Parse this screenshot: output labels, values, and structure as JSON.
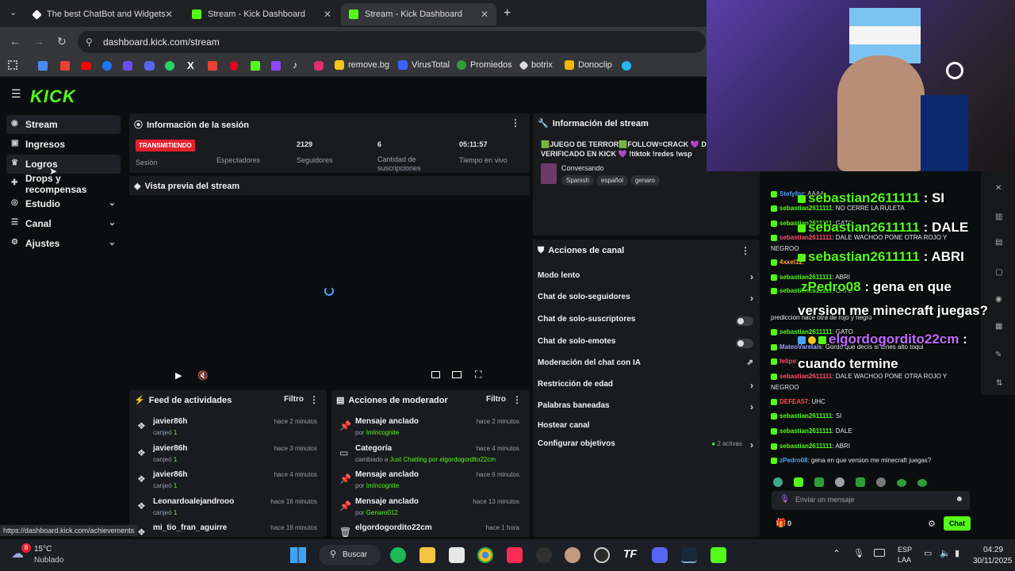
{
  "browser": {
    "tabs": [
      {
        "title": "The best ChatBot and Widgets"
      },
      {
        "title": "Stream - Kick Dashboard"
      },
      {
        "title": "Stream - Kick Dashboard"
      }
    ],
    "url": "dashboard.kick.com/stream",
    "bookmarks": [
      "remove.bg",
      "VirusTotal",
      "Promiedos",
      "botrix",
      "Donoclip"
    ],
    "status_url": "https://dashboard.kick.com/achievements"
  },
  "sidebar": {
    "items": [
      {
        "label": "Stream"
      },
      {
        "label": "Ingresos"
      },
      {
        "label": "Logros"
      },
      {
        "label": "Drops y recompensas"
      },
      {
        "label": "Estudio"
      },
      {
        "label": "Canal"
      },
      {
        "label": "Ajustes"
      }
    ]
  },
  "session": {
    "title": "Información de la sesión",
    "live_badge": "TRANSMITIENDO",
    "session_label": "Sesión",
    "viewers_label": "Espectadores",
    "followers_value": "2129",
    "followers_label": "Seguidores",
    "subs_value": "6",
    "subs_label": "Cantidad de suscripciones",
    "live_time_value": "05:11:57",
    "live_time_label": "Tiempo en vivo"
  },
  "preview": {
    "title": "Vista previa del stream"
  },
  "stream_info": {
    "title": "Información del stream",
    "stream_title": "🟩JUEGO DE TERROR🟩FOLLOW=CRACK 💜 DE ( VERIFICADO EN KICK 💜 !tiktok !redes !wsp",
    "category": "Conversando",
    "tags": [
      "Spanish",
      "español",
      "genaro"
    ]
  },
  "channel_actions": {
    "title": "Acciones de canal",
    "items": [
      {
        "label": "Modo lento",
        "kind": "arrow"
      },
      {
        "label": "Chat de solo-seguidores",
        "kind": "arrow"
      },
      {
        "label": "Chat de solo-suscriptores",
        "kind": "toggle"
      },
      {
        "label": "Chat de solo-emotes",
        "kind": "toggle"
      },
      {
        "label": "Moderación del chat con IA",
        "kind": "link"
      },
      {
        "label": "Restricción de edad",
        "kind": "arrow"
      },
      {
        "label": "Palabras baneadas",
        "kind": "arrow"
      },
      {
        "label": "Hostear canal",
        "kind": "none"
      },
      {
        "label": "Configurar objetivos",
        "kind": "arrow"
      }
    ],
    "goals_status": "2 activas"
  },
  "activity_feed": {
    "title": "Feed de actividades",
    "filter": "Filtro",
    "items": [
      {
        "user": "javier86h",
        "detail_prefix": "canjeó",
        "detail_value": "1",
        "time": "hace 2 minutos"
      },
      {
        "user": "javier86h",
        "detail_prefix": "canjeó",
        "detail_value": "1",
        "time": "hace 3 minutos"
      },
      {
        "user": "javier86h",
        "detail_prefix": "canjeó",
        "detail_value": "1",
        "time": "hace 4 minutos"
      },
      {
        "user": "Leonardoalejandrooo",
        "detail_prefix": "canjeó",
        "detail_value": "1",
        "time": "hace 16 minutos"
      },
      {
        "user": "mi_tio_fran_aguirre",
        "detail_prefix": "",
        "detail_value": "",
        "time": "hace 16 minutos"
      }
    ]
  },
  "mod_actions": {
    "title": "Acciones de moderador",
    "filter": "Filtro",
    "items": [
      {
        "action": "Mensaje anclado",
        "detail_prefix": "por",
        "detail_value": "ImIncognite",
        "time": "hace 2 minutos"
      },
      {
        "action": "Categoría",
        "detail_prefix": "cambiado a",
        "detail_value": "Just Chatting por elgordogordito22cm",
        "time": "hace 4 minutos"
      },
      {
        "action": "Mensaje anclado",
        "detail_prefix": "por",
        "detail_value": "ImIncognite",
        "time": "hace 6 minutos"
      },
      {
        "action": "Mensaje anclado",
        "detail_prefix": "por",
        "detail_value": "Genaro012",
        "time": "hace 13 minutos"
      },
      {
        "action": "elgordogordito22cm",
        "detail_prefix": "",
        "detail_value": "",
        "time": "hace 1 hora"
      }
    ]
  },
  "chat": {
    "lines": [
      {
        "user": "Stefyfnz",
        "text": "AAAA",
        "color": "#4aa3ff"
      },
      {
        "user": "sebastian2611111",
        "text": "NO CERRE LA RULETA",
        "color": "#53fc18"
      },
      {
        "user": "sebastian2611111",
        "text": "GATO",
        "color": "#53fc18"
      },
      {
        "user": "sebastian2611111",
        "text": "DALE WACHOO PONE OTRA ROJO Y",
        "color": "#ff4d6d"
      },
      {
        "user": "",
        "text": "NEGROO",
        "color": "#ffffff"
      },
      {
        "user": "4xxel12",
        "text": "",
        "color": "#ff9d2e"
      },
      {
        "user": "sebastian2611111",
        "text": "ABRI",
        "color": "#53fc18"
      },
      {
        "user": "sebastian2611111",
        "text": "CATO",
        "color": "#53fc18"
      },
      {
        "user": "",
        "text": "prediccion hace otra de rojo y negro",
        "color": "#ffffff"
      },
      {
        "user": "sebastian2611111",
        "text": "GATO",
        "color": "#53fc18"
      },
      {
        "user": "MateoVarelais",
        "text": "Gordo que decís si tenes alto toqui",
        "color": "#9aa0ff"
      },
      {
        "user": "felipe",
        "text": "",
        "color": "#ff4d6d"
      },
      {
        "user": "sebastian2611111",
        "text": "DALE WACHOO PONE OTRA ROJO Y",
        "color": "#ff4d6d"
      },
      {
        "user": "",
        "text": "NEGROO",
        "color": "#ffffff"
      },
      {
        "user": "DEFEA57",
        "text": "UHC",
        "color": "#ff4d4d"
      },
      {
        "user": "sebastian2611111",
        "text": "SI",
        "color": "#53fc18"
      },
      {
        "user": "sebastian2611111",
        "text": "DALE",
        "color": "#53fc18"
      },
      {
        "user": "sebastian2611111",
        "text": "ABRI",
        "color": "#53fc18"
      },
      {
        "user": "zPedro08",
        "text": "gena en que version me minecraft juegas?",
        "color": "#4aa3ff"
      }
    ],
    "input_placeholder": "Enviar un mensaje",
    "points": "0",
    "send_label": "Chat"
  },
  "overlay": {
    "lines": [
      {
        "user": "sebastian2611111",
        "text": "SI"
      },
      {
        "user": "sebastian2611111",
        "text": "DALE"
      },
      {
        "user": "sebastian2611111",
        "text": "ABRI"
      }
    ],
    "q_user": "zPedro08",
    "q_text1": "gena en que",
    "q_text2": "version me minecraft juegas?",
    "u2": "elgordogordito22cm",
    "u2_text": "cuando termine"
  },
  "taskbar": {
    "temp": "15°C",
    "weather": "Nublado",
    "weather_badge": "8",
    "search": "Buscar",
    "lang1": "ESP",
    "lang2": "LAA",
    "time": "04:29",
    "date": "30/11/2025"
  },
  "colors": {
    "kick_green": "#53fc18",
    "live_red": "#e5202e",
    "panel": "#191b1f"
  }
}
